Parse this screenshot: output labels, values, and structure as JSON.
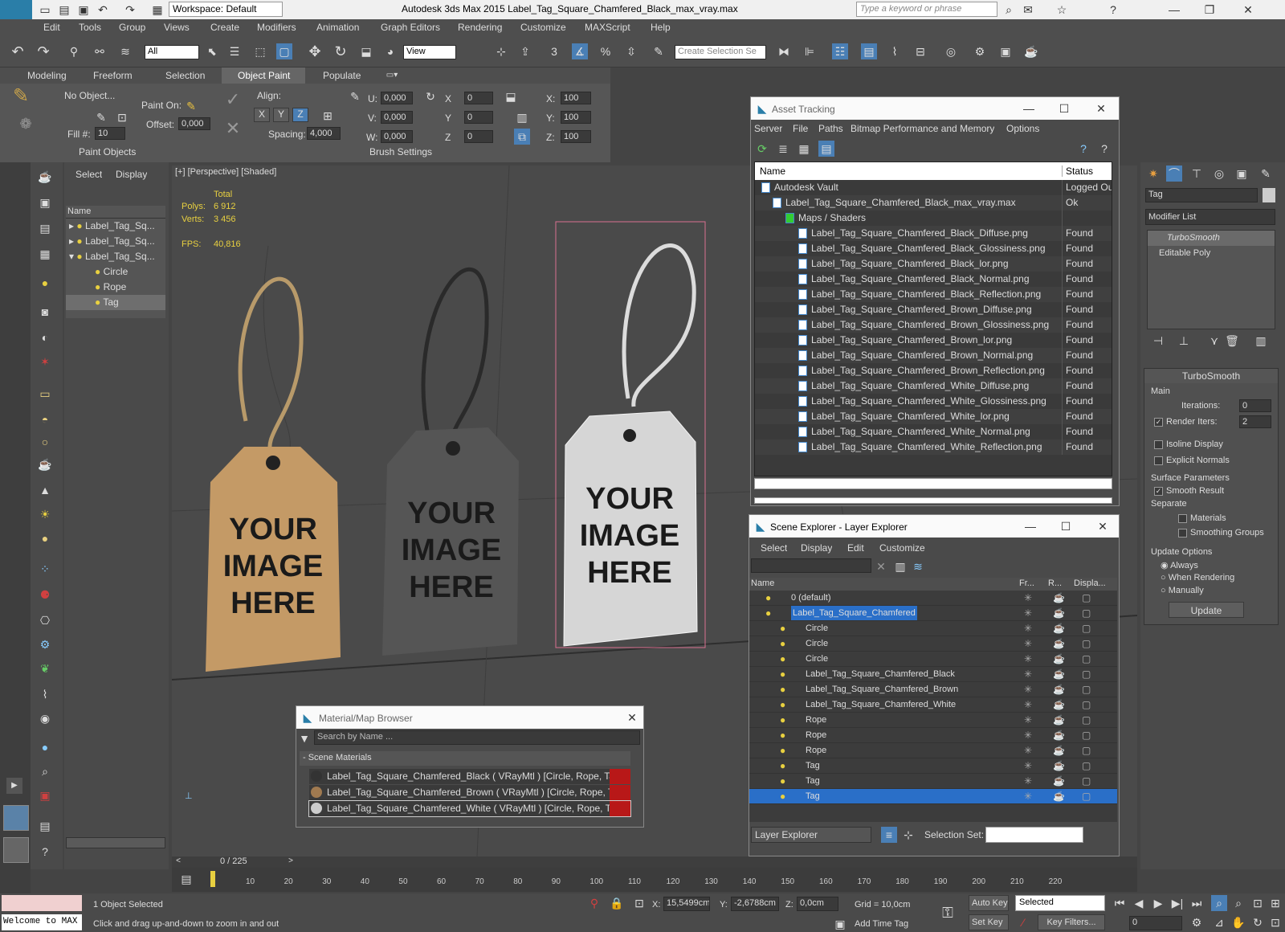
{
  "app": {
    "logo": "MAX",
    "workspace": "Workspace: Default",
    "title": "Autodesk 3ds Max  2015     Label_Tag_Square_Chamfered_Black_max_vray.max",
    "search_placeholder": "Type a keyword or phrase"
  },
  "menu": [
    "Edit",
    "Tools",
    "Group",
    "Views",
    "Create",
    "Modifiers",
    "Animation",
    "Graph Editors",
    "Rendering",
    "Customize",
    "MAXScript",
    "Help"
  ],
  "toolbar": {
    "filter": "All",
    "view": "View",
    "selection_set": "Create Selection Se",
    "snap_3": "3",
    "snap_pct": "%"
  },
  "ribbon": {
    "tabs": [
      "Modeling",
      "Freeform",
      "Selection",
      "Object Paint",
      "Populate"
    ],
    "active_tab": "Object Paint",
    "no_object": "No Object...",
    "paint_on": "Paint On:",
    "fill_label": "Fill #:",
    "fill_value": "10",
    "offset_label": "Offset:",
    "offset_value": "0,000",
    "align_label": "Align:",
    "x": "X",
    "y": "Y",
    "z": "Z",
    "spacing_label": "Spacing:",
    "spacing_value": "4,000",
    "u_label": "U:",
    "u_value": "0,000",
    "v_label": "V:",
    "v_value": "0,000",
    "w_label": "W:",
    "w_value": "0,000",
    "rx": "X",
    "rx_value": "0",
    "ry": "Y",
    "ry_value": "0",
    "rz": "Z",
    "rz_value": "0",
    "sx": "X:",
    "sx_value": "100",
    "sy": "Y:",
    "sy_value": "100",
    "sz": "Z:",
    "sz_value": "100",
    "paint_objects": "Paint Objects",
    "brush_settings": "Brush Settings"
  },
  "scene_side": {
    "tabs": [
      "Select",
      "Display"
    ],
    "header": "Name",
    "items": [
      "Label_Tag_Sq...",
      "Label_Tag_Sq...",
      "Label_Tag_Sq...",
      "Circle",
      "Rope",
      "Tag"
    ]
  },
  "viewport": {
    "label": "[+] [Perspective] [Shaded]",
    "total": "Total",
    "polys_label": "Polys:",
    "polys": "6 912",
    "verts_label": "Verts:",
    "verts": "3 456",
    "fps_label": "FPS:",
    "fps": "40,816",
    "tag_text": [
      "YOUR",
      "IMAGE",
      "HERE"
    ]
  },
  "asset": {
    "title": "Asset Tracking",
    "menu": [
      "Server",
      "File",
      "Paths",
      "Bitmap Performance and Memory",
      "Options"
    ],
    "col_name": "Name",
    "col_status": "Status",
    "rows": [
      {
        "name": "Autodesk Vault",
        "status": "Logged Out"
      },
      {
        "name": "Label_Tag_Square_Chamfered_Black_max_vray.max",
        "status": "Ok"
      },
      {
        "name": "Maps / Shaders",
        "status": ""
      },
      {
        "name": "Label_Tag_Square_Chamfered_Black_Diffuse.png",
        "status": "Found"
      },
      {
        "name": "Label_Tag_Square_Chamfered_Black_Glossiness.png",
        "status": "Found"
      },
      {
        "name": "Label_Tag_Square_Chamfered_Black_lor.png",
        "status": "Found"
      },
      {
        "name": "Label_Tag_Square_Chamfered_Black_Normal.png",
        "status": "Found"
      },
      {
        "name": "Label_Tag_Square_Chamfered_Black_Reflection.png",
        "status": "Found"
      },
      {
        "name": "Label_Tag_Square_Chamfered_Brown_Diffuse.png",
        "status": "Found"
      },
      {
        "name": "Label_Tag_Square_Chamfered_Brown_Glossiness.png",
        "status": "Found"
      },
      {
        "name": "Label_Tag_Square_Chamfered_Brown_lor.png",
        "status": "Found"
      },
      {
        "name": "Label_Tag_Square_Chamfered_Brown_Normal.png",
        "status": "Found"
      },
      {
        "name": "Label_Tag_Square_Chamfered_Brown_Reflection.png",
        "status": "Found"
      },
      {
        "name": "Label_Tag_Square_Chamfered_White_Diffuse.png",
        "status": "Found"
      },
      {
        "name": "Label_Tag_Square_Chamfered_White_Glossiness.png",
        "status": "Found"
      },
      {
        "name": "Label_Tag_Square_Chamfered_White_lor.png",
        "status": "Found"
      },
      {
        "name": "Label_Tag_Square_Chamfered_White_Normal.png",
        "status": "Found"
      },
      {
        "name": "Label_Tag_Square_Chamfered_White_Reflection.png",
        "status": "Found"
      }
    ]
  },
  "explorer": {
    "title": "Scene Explorer - Layer Explorer",
    "menu": [
      "Select",
      "Display",
      "Edit",
      "Customize"
    ],
    "col_name": "Name",
    "col_fr": "Fr...",
    "col_r": "R...",
    "col_disp": "Displa...",
    "rows": [
      {
        "name": "0 (default)",
        "level": 0
      },
      {
        "name": "Label_Tag_Square_Chamfered",
        "level": 0
      },
      {
        "name": "Circle",
        "level": 1
      },
      {
        "name": "Circle",
        "level": 1
      },
      {
        "name": "Circle",
        "level": 1
      },
      {
        "name": "Label_Tag_Square_Chamfered_Black",
        "level": 1
      },
      {
        "name": "Label_Tag_Square_Chamfered_Brown",
        "level": 1
      },
      {
        "name": "Label_Tag_Square_Chamfered_White",
        "level": 1
      },
      {
        "name": "Rope",
        "level": 1
      },
      {
        "name": "Rope",
        "level": 1
      },
      {
        "name": "Rope",
        "level": 1
      },
      {
        "name": "Tag",
        "level": 1
      },
      {
        "name": "Tag",
        "level": 1
      },
      {
        "name": "Tag",
        "level": 1
      }
    ],
    "footer_mode": "Layer Explorer",
    "selection_set_label": "Selection Set:"
  },
  "material": {
    "title": "Material/Map Browser",
    "search_placeholder": "Search by Name ...",
    "group": "- Scene Materials",
    "items": [
      "Label_Tag_Square_Chamfered_Black  ( VRayMtl )  [Circle, Rope, Tag]",
      "Label_Tag_Square_Chamfered_Brown  ( VRayMtl )  [Circle, Rope, Tag]",
      "Label_Tag_Square_Chamfered_White  ( VRayMtl )  [Circle, Rope, Tag]"
    ]
  },
  "cmd": {
    "object_name": "Tag",
    "modifier_list": "Modifier List",
    "stack": [
      "TurboSmooth",
      "Editable Poly"
    ],
    "rollout": "TurboSmooth",
    "main": "Main",
    "iterations_label": "Iterations:",
    "iterations": "0",
    "render_iters_label": "Render Iters:",
    "render_iters": "2",
    "isoline": "Isoline Display",
    "explicit_normals": "Explicit Normals",
    "surface_params": "Surface Parameters",
    "smooth_result": "Smooth Result",
    "separate": "Separate",
    "materials": "Materials",
    "smoothing_groups": "Smoothing Groups",
    "update_options": "Update Options",
    "always": "Always",
    "when_rendering": "When Rendering",
    "manually": "Manually",
    "update": "Update"
  },
  "timeline": {
    "frame": "0 / 225",
    "ticks": [
      "10",
      "20",
      "30",
      "40",
      "50",
      "60",
      "70",
      "80",
      "90",
      "100",
      "110",
      "120",
      "130",
      "140",
      "150",
      "160",
      "170",
      "180",
      "190",
      "200",
      "210",
      "220"
    ]
  },
  "status": {
    "maxscript": "Welcome to MAX",
    "selected": "1 Object Selected",
    "prompt": "Click and drag up-and-down to zoom in and out",
    "x_label": "X:",
    "x": "15,5499cm",
    "y_label": "Y:",
    "y": "-2,6788cm",
    "z_label": "Z:",
    "z": "0,0cm",
    "grid": "Grid = 10,0cm",
    "add_time_tag": "Add Time Tag",
    "auto_key": "Auto Key",
    "set_key": "Set Key",
    "selected_dd": "Selected",
    "key_filters": "Key Filters...",
    "frame_field": "0"
  }
}
